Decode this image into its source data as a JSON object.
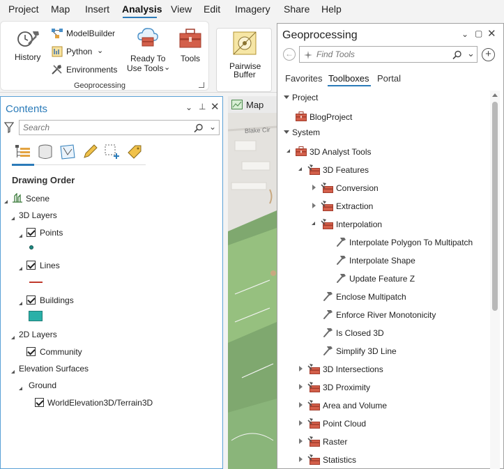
{
  "menu": {
    "items": [
      "Project",
      "Map",
      "Insert",
      "Analysis",
      "View",
      "Edit",
      "Imagery",
      "Share",
      "Help"
    ],
    "active": "Analysis"
  },
  "ribbon": {
    "history_label": "History",
    "modelbuilder_label": "ModelBuilder",
    "python_label": "Python",
    "environments_label": "Environments",
    "ready_to_use_line1": "Ready To",
    "ready_to_use_line2": "Use Tools",
    "tools_label": "Tools",
    "group_label": "Geoprocessing",
    "pairwise_line1": "Pairwise",
    "pairwise_line2": "Buffer"
  },
  "contents": {
    "title": "Contents",
    "search_placeholder": "Search",
    "drawing_order": "Drawing Order",
    "scene": "Scene",
    "layers_3d": "3D Layers",
    "points": "Points",
    "lines": "Lines",
    "buildings": "Buildings",
    "layers_2d": "2D Layers",
    "community": "Community",
    "elevation_surfaces": "Elevation Surfaces",
    "ground": "Ground",
    "terrain": "WorldElevation3D/Terrain3D",
    "colors": {
      "points": "#1e8a82",
      "lines": "#c0392b",
      "buildings": "#2ab0a8"
    }
  },
  "map": {
    "tab_label": "Map",
    "street_label": "Blake Cir"
  },
  "geoprocessing": {
    "title": "Geoprocessing",
    "search_placeholder": "Find Tools",
    "tabs": [
      "Favorites",
      "Toolboxes",
      "Portal"
    ],
    "active_tab": "Toolboxes",
    "project": "Project",
    "blog_project": "BlogProject",
    "system": "System",
    "analyst_tools": "3D Analyst Tools",
    "features_3d": "3D Features",
    "conversion": "Conversion",
    "extraction": "Extraction",
    "interpolation": "Interpolation",
    "interp_polygon": "Interpolate Polygon To Multipatch",
    "interp_shape": "Interpolate Shape",
    "update_feature_z": "Update Feature Z",
    "enclose_multipatch": "Enclose Multipatch",
    "enforce_river": "Enforce River Monotonicity",
    "is_closed": "Is Closed 3D",
    "simplify_line": "Simplify 3D Line",
    "intersections": "3D Intersections",
    "proximity": "3D Proximity",
    "area_volume": "Area and Volume",
    "point_cloud": "Point Cloud",
    "raster": "Raster",
    "statistics": "Statistics"
  },
  "colors": {
    "accent": "#2b7bb9",
    "toolbox": "#c0504d"
  }
}
